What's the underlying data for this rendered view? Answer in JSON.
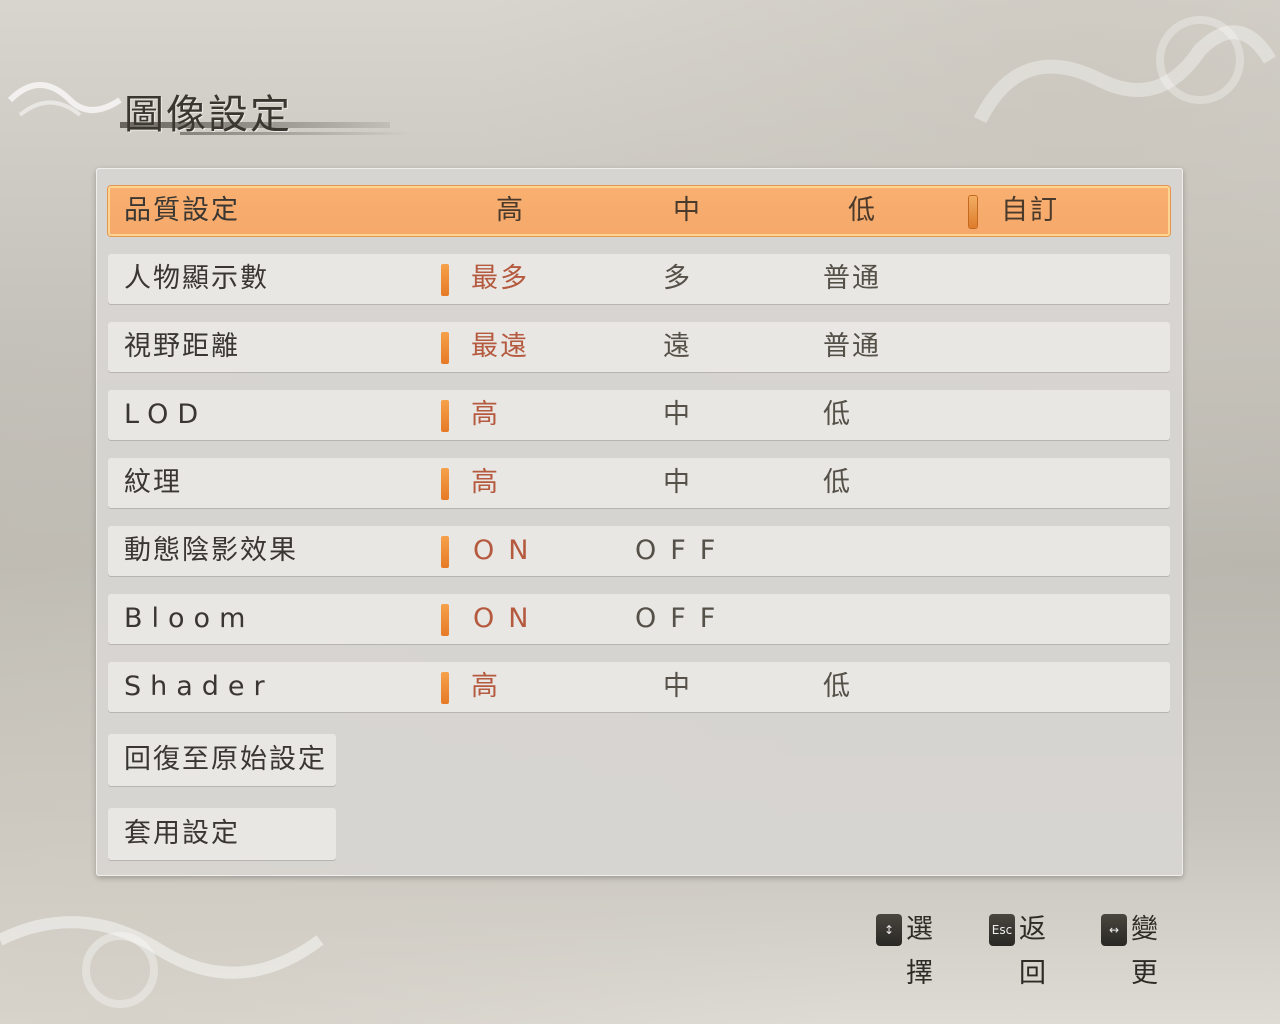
{
  "title": "圖像設定",
  "rows": [
    {
      "label": "品質設定",
      "latin": false,
      "selected": true,
      "marker_index": 3,
      "options": [
        {
          "text": "高",
          "active": false
        },
        {
          "text": "中",
          "active": false
        },
        {
          "text": "低",
          "active": false
        },
        {
          "text": "自訂",
          "active": true
        }
      ]
    },
    {
      "label": "人物顯示數",
      "latin": false,
      "selected": false,
      "marker_index": 0,
      "options": [
        {
          "text": "最多",
          "active": true
        },
        {
          "text": "多",
          "active": false
        },
        {
          "text": "普通",
          "active": false
        }
      ]
    },
    {
      "label": "視野距離",
      "latin": false,
      "selected": false,
      "marker_index": 0,
      "options": [
        {
          "text": "最遠",
          "active": true
        },
        {
          "text": "遠",
          "active": false
        },
        {
          "text": "普通",
          "active": false
        }
      ]
    },
    {
      "label": "LOD",
      "latin": true,
      "selected": false,
      "marker_index": 0,
      "options": [
        {
          "text": "高",
          "active": true
        },
        {
          "text": "中",
          "active": false
        },
        {
          "text": "低",
          "active": false
        }
      ]
    },
    {
      "label": "紋理",
      "latin": false,
      "selected": false,
      "marker_index": 0,
      "options": [
        {
          "text": "高",
          "active": true
        },
        {
          "text": "中",
          "active": false
        },
        {
          "text": "低",
          "active": false
        }
      ]
    },
    {
      "label": "動態陰影效果",
      "latin": false,
      "selected": false,
      "marker_index": 0,
      "options": [
        {
          "text": "ON",
          "active": true,
          "latin": true
        },
        {
          "text": "OFF",
          "active": false,
          "latin": true
        }
      ]
    },
    {
      "label": "Bloom",
      "latin": true,
      "selected": false,
      "marker_index": 0,
      "options": [
        {
          "text": "ON",
          "active": true,
          "latin": true
        },
        {
          "text": "OFF",
          "active": false,
          "latin": true
        }
      ]
    },
    {
      "label": "Shader",
      "latin": true,
      "selected": false,
      "marker_index": 0,
      "options": [
        {
          "text": "高",
          "active": true
        },
        {
          "text": "中",
          "active": false
        },
        {
          "text": "低",
          "active": false
        }
      ]
    }
  ],
  "buttons": {
    "reset": "回復至原始設定",
    "apply": "套用設定"
  },
  "hints": [
    {
      "key": "↕",
      "label": "選擇",
      "icon": "updown-key-icon"
    },
    {
      "key": "Esc",
      "label": "返回",
      "icon": "esc-key-icon"
    },
    {
      "key": "↔",
      "label": "變更",
      "icon": "leftright-key-icon"
    }
  ],
  "colors": {
    "selected_row": "#f5a86a",
    "active_option": "#b55a3e",
    "marker": "#e67a26"
  }
}
